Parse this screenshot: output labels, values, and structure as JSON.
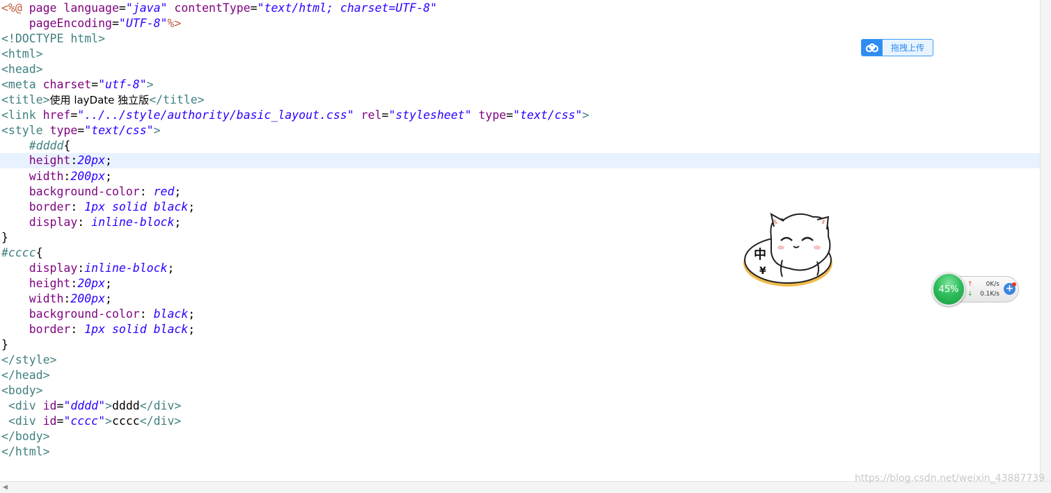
{
  "code": {
    "l1": {
      "jsp_open": "<%@",
      "kw1": " page ",
      "a1": "language",
      "eq1": "=",
      "v1": "\"java\"",
      "a2": " contentType",
      "eq2": "=",
      "v2": "\"text/html; charset=UTF-8\""
    },
    "l2": {
      "indent": "    ",
      "a1": "pageEncoding",
      "eq1": "=",
      "v1": "\"UTF-8\"",
      "jsp_close": "%>"
    },
    "l3": {
      "t": "<!DOCTYPE html>"
    },
    "l4": {
      "t": "<html>"
    },
    "l5": {
      "t": "<head>"
    },
    "l6": {
      "tag": "<meta",
      "a1": " charset",
      "eq1": "=",
      "v1": "\"utf-8\"",
      "close": ">"
    },
    "l7": {
      "open": "<title>",
      "text": "使用 layDate 独立版",
      "close": "</title>"
    },
    "l8": {
      "tag": "<link",
      "a1": " href",
      "eq1": "=",
      "v1": "\"../../style/authority/basic_layout.css\"",
      "a2": " rel",
      "eq2": "=",
      "v2": "\"stylesheet\"",
      "a3": " type",
      "eq3": "=",
      "v3": "\"text/css\"",
      "close": ">"
    },
    "l9": {
      "tag": "<style",
      "a1": " type",
      "eq1": "=",
      "v1": "\"text/css\"",
      "close": ">"
    },
    "l10": {
      "indent": "    ",
      "sel": "#dddd",
      "brace": "{"
    },
    "l11": {
      "indent": "    ",
      "prop": "height",
      "colon": ":",
      "val": "20px",
      "semi": ";"
    },
    "l12": {
      "indent": "    ",
      "prop": "width",
      "colon": ":",
      "val": "200px",
      "semi": ";"
    },
    "l13": {
      "indent": "    ",
      "prop": "background-color",
      "colon": ": ",
      "val": "red",
      "semi": ";"
    },
    "l14": {
      "indent": "    ",
      "prop": "border",
      "colon": ": ",
      "val": "1px solid black",
      "semi": ";"
    },
    "l15": {
      "indent": "    ",
      "prop": "display",
      "colon": ": ",
      "val": "inline-block",
      "semi": ";"
    },
    "l16": {
      "t": "}"
    },
    "l17": {
      "sel": "#cccc",
      "brace": "{"
    },
    "l18": {
      "indent": "    ",
      "prop": "display",
      "colon": ":",
      "val": "inline-block",
      "semi": ";"
    },
    "l19": {
      "indent": "    ",
      "prop": "height",
      "colon": ":",
      "val": "20px",
      "semi": ";"
    },
    "l20": {
      "indent": "    ",
      "prop": "width",
      "colon": ":",
      "val": "200px",
      "semi": ";"
    },
    "l21": {
      "indent": "    ",
      "prop": "background-color",
      "colon": ": ",
      "val": "black",
      "semi": ";"
    },
    "l22": {
      "indent": "    ",
      "prop": "border",
      "colon": ": ",
      "val": "1px solid black",
      "semi": ";"
    },
    "l23": {
      "t": "}"
    },
    "l24": {
      "t": "</style>"
    },
    "l25": {
      "t": "</head>"
    },
    "l26": {
      "t": "<body>"
    },
    "l27": {
      "indent": " ",
      "tag": "<div",
      "a1": " id",
      "eq1": "=",
      "v1": "\"dddd\"",
      "gt": ">",
      "text": "dddd",
      "close": "</div>"
    },
    "l28": {
      "indent": " ",
      "tag": "<div",
      "a1": " id",
      "eq1": "=",
      "v1": "\"cccc\"",
      "gt": ">",
      "text": "cccc",
      "close": "</div>"
    },
    "l29": {
      "t": "</body>"
    },
    "l30": {
      "t": "</html>"
    }
  },
  "upload_button": {
    "label": "拖拽上传",
    "icon": "cloud-upload-icon",
    "color": "#2f8cf0"
  },
  "sticker": {
    "badge": "中",
    "symbol": "¥",
    "icon": "cat-sticker-icon"
  },
  "net_monitor": {
    "percent": "45%",
    "up_speed": "0K/s",
    "down_speed": "0.1K/s",
    "up_icon": "arrow-up-icon",
    "down_icon": "arrow-down-icon",
    "add_icon": "plus-icon"
  },
  "watermark": {
    "text": "https://blog.csdn.net/weixin_43887739"
  },
  "colors": {
    "jsp": "#bf5f3f",
    "tag": "#3f7f7f",
    "attr": "#7f007f",
    "string": "#2a00ff",
    "current_line": "#e8f2fe"
  }
}
